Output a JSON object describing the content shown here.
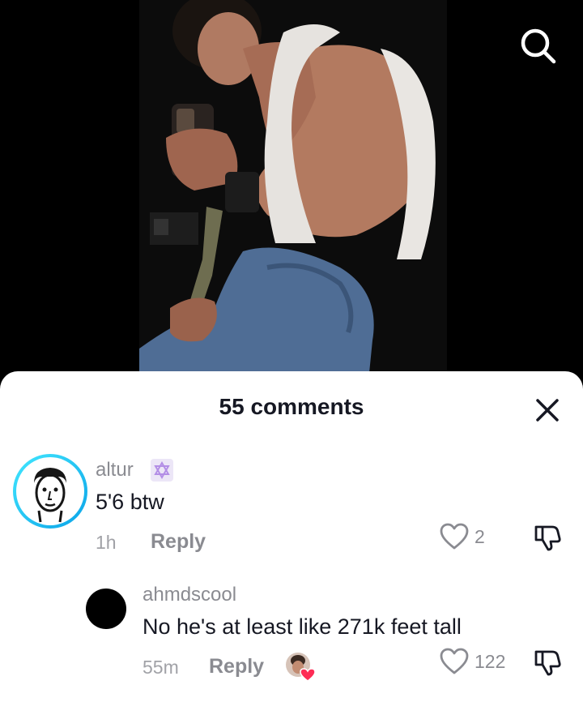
{
  "video": {
    "search_icon": "search-icon"
  },
  "sheet": {
    "title": "55 comments",
    "close_icon": "close-icon"
  },
  "comments": [
    {
      "username": "altur",
      "badge_icon": "star-of-david-icon",
      "text": "5'6 btw",
      "time": "1h",
      "reply_label": "Reply",
      "like_count": "2"
    },
    {
      "username": "ahmdscool",
      "text": "No he's at least like 271k feet tall",
      "time": "55m",
      "reply_label": "Reply",
      "like_count": "122",
      "creator_liked_icon": "creator-liked-avatar-icon"
    }
  ],
  "colors": {
    "accent_ring_start": "#3ee6ff",
    "accent_ring_end": "#00a2e8",
    "heart": "#fe2c55",
    "badge": "#b38ee6"
  }
}
